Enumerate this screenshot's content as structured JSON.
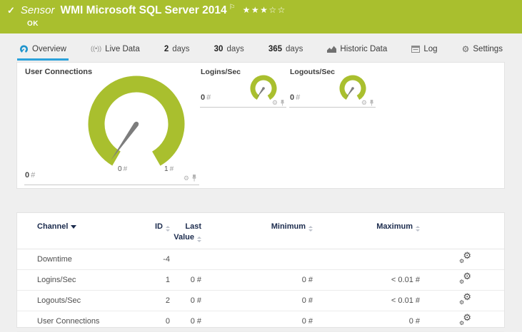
{
  "colors": {
    "brand_green": "#a9bf2e",
    "accent_blue": "#2ba2db",
    "table_header_navy": "#1b2b4d",
    "needle_gray": "#7d7d7d"
  },
  "icons": {
    "check": "✓",
    "flag": "⚐",
    "stars": "★★★☆☆",
    "gear": "⚙",
    "broadcast": "((•))"
  },
  "sensor_header": {
    "kind": "Sensor",
    "title": "WMI Microsoft SQL Server 2014",
    "status": "OK"
  },
  "tabs": {
    "overview": "Overview",
    "live_data": "Live Data",
    "days2_num": "2",
    "days2_word": "days",
    "days30_num": "30",
    "days30_word": "days",
    "days365_num": "365",
    "days365_word": "days",
    "historic": "Historic Data",
    "log": "Log",
    "settings": "Settings"
  },
  "gauges": {
    "primary": {
      "title": "User Connections",
      "value": "0",
      "unit": "#",
      "scale_min": "0",
      "scale_min_unit": "#",
      "scale_max": "1",
      "scale_max_unit": "#"
    },
    "logins": {
      "title": "Logins/Sec",
      "value": "0",
      "unit": "#"
    },
    "logouts": {
      "title": "Logouts/Sec",
      "value": "0",
      "unit": "#"
    }
  },
  "channel_table": {
    "headers": {
      "channel": "Channel",
      "id": "ID",
      "last_value": "Last Value",
      "minimum": "Minimum",
      "maximum": "Maximum"
    },
    "rows": [
      {
        "channel": "Downtime",
        "id": "-4",
        "last": "",
        "min": "",
        "max": ""
      },
      {
        "channel": "Logins/Sec",
        "id": "1",
        "last": "0 #",
        "min": "0 #",
        "max": "< 0.01 #"
      },
      {
        "channel": "Logouts/Sec",
        "id": "2",
        "last": "0 #",
        "min": "0 #",
        "max": "< 0.01 #"
      },
      {
        "channel": "User Connections",
        "id": "0",
        "last": "0 #",
        "min": "0 #",
        "max": "0 #"
      }
    ]
  }
}
